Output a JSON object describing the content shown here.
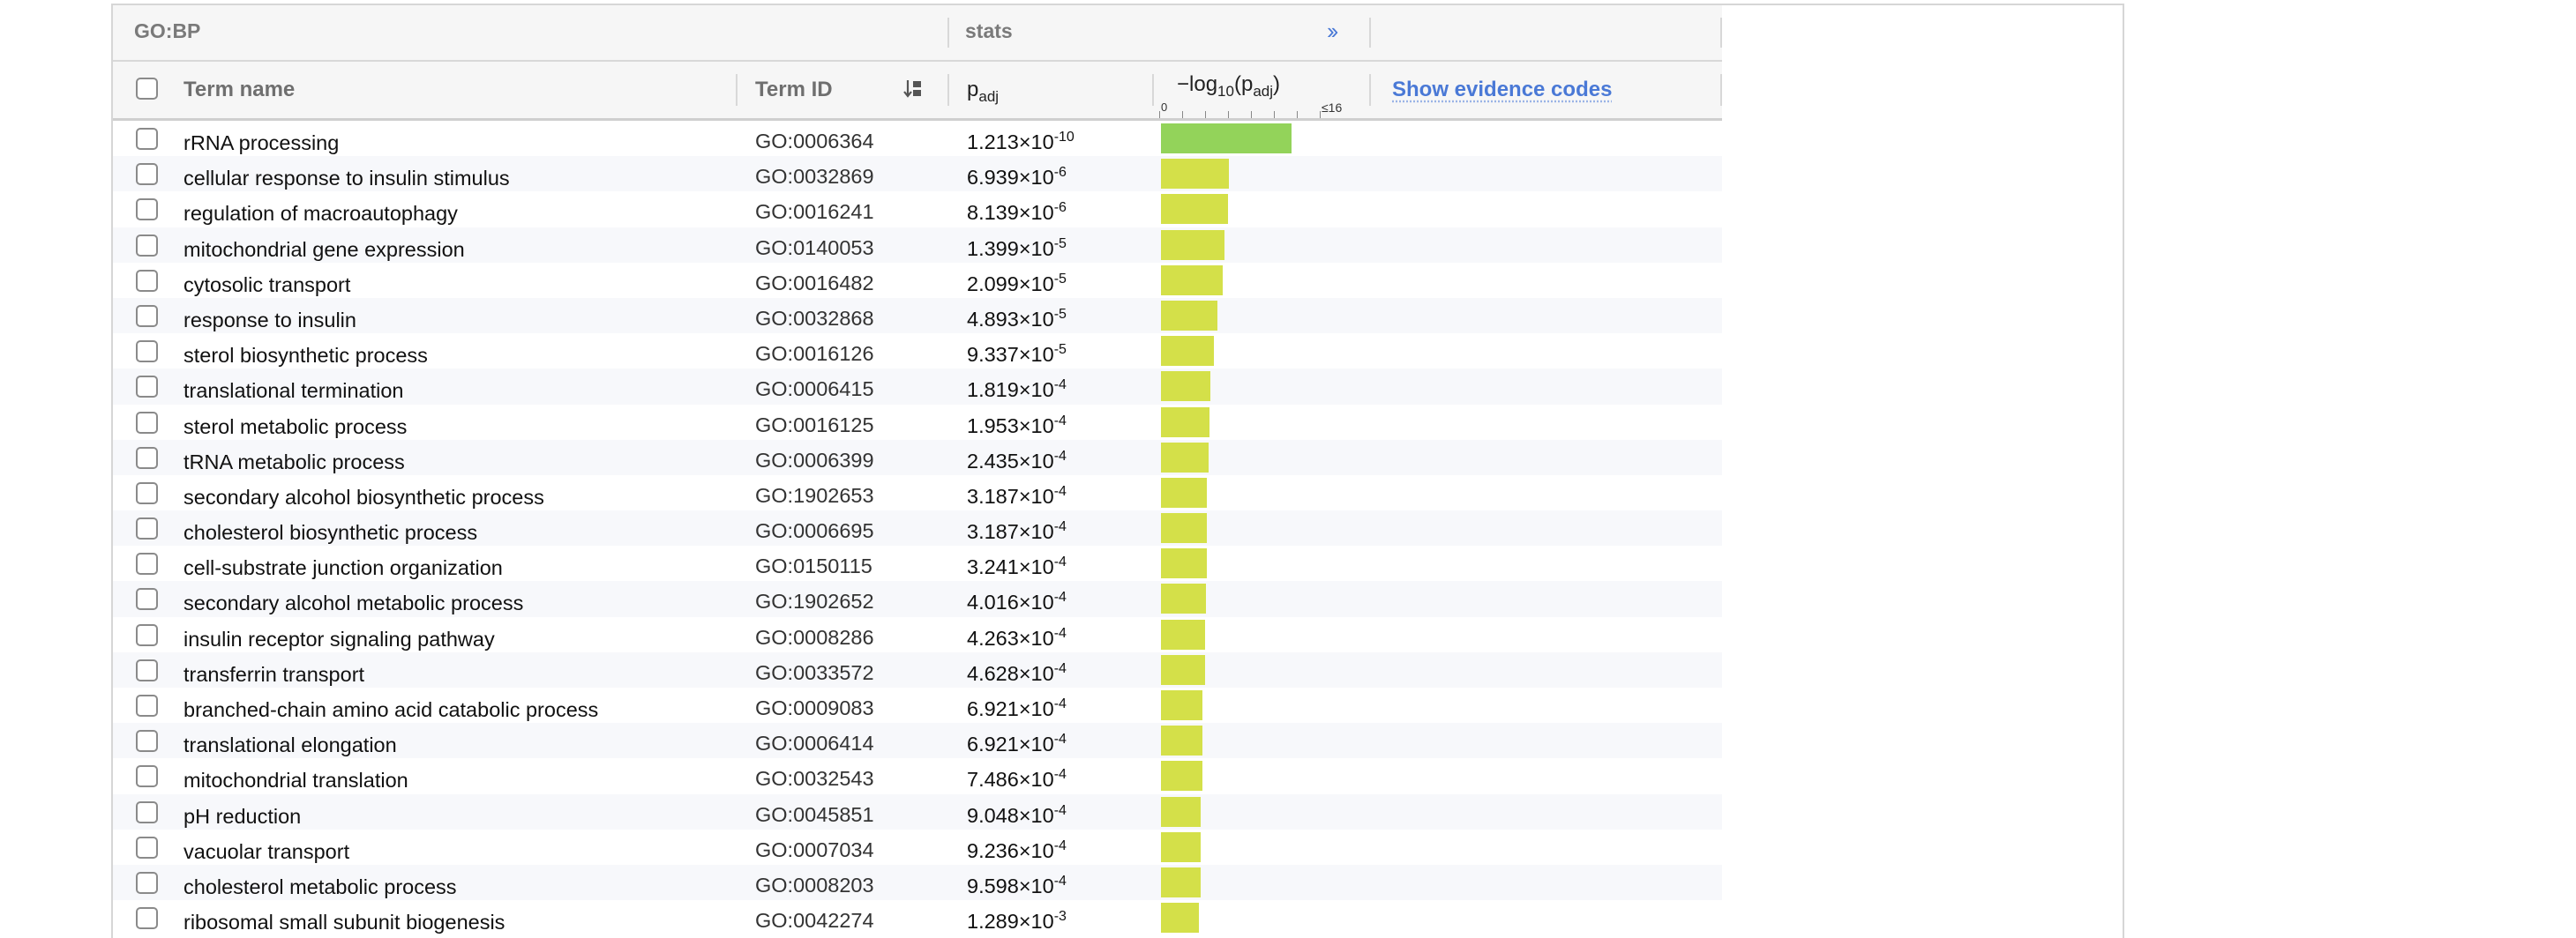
{
  "table": {
    "group_label": "GO:BP",
    "stats_label": "stats",
    "expand_glyph": "››",
    "headers": {
      "term_name": "Term name",
      "term_id": "Term ID",
      "padj_base": "p",
      "padj_sub": "adj",
      "log_prefix": "−log",
      "log_sub": "10",
      "log_open": "(p",
      "log_inner_sub": "adj",
      "log_close": ")",
      "axis_zero": "0",
      "axis_max": "≤16",
      "evidence_link": "Show evidence codes"
    },
    "axis_max_value": 16,
    "bar_colors": {
      "strong": "#93d35a",
      "normal": "#d4e049"
    },
    "icons": {
      "sort": "sort-icon",
      "expand": "double-chevron-right-icon"
    },
    "rows": [
      {
        "name": "rRNA processing",
        "id": "GO:0006364",
        "p_mant": "1.213",
        "p_exp": "-10",
        "neglog": 9.92
      },
      {
        "name": "cellular response to insulin stimulus",
        "id": "GO:0032869",
        "p_mant": "6.939",
        "p_exp": "-6",
        "neglog": 5.16
      },
      {
        "name": "regulation of macroautophagy",
        "id": "GO:0016241",
        "p_mant": "8.139",
        "p_exp": "-6",
        "neglog": 5.09
      },
      {
        "name": "mitochondrial gene expression",
        "id": "GO:0140053",
        "p_mant": "1.399",
        "p_exp": "-5",
        "neglog": 4.85
      },
      {
        "name": "cytosolic transport",
        "id": "GO:0016482",
        "p_mant": "2.099",
        "p_exp": "-5",
        "neglog": 4.68
      },
      {
        "name": "response to insulin",
        "id": "GO:0032868",
        "p_mant": "4.893",
        "p_exp": "-5",
        "neglog": 4.31
      },
      {
        "name": "sterol biosynthetic process",
        "id": "GO:0016126",
        "p_mant": "9.337",
        "p_exp": "-5",
        "neglog": 4.03
      },
      {
        "name": "translational termination",
        "id": "GO:0006415",
        "p_mant": "1.819",
        "p_exp": "-4",
        "neglog": 3.74
      },
      {
        "name": "sterol metabolic process",
        "id": "GO:0016125",
        "p_mant": "1.953",
        "p_exp": "-4",
        "neglog": 3.71
      },
      {
        "name": "tRNA metabolic process",
        "id": "GO:0006399",
        "p_mant": "2.435",
        "p_exp": "-4",
        "neglog": 3.61
      },
      {
        "name": "secondary alcohol biosynthetic process",
        "id": "GO:1902653",
        "p_mant": "3.187",
        "p_exp": "-4",
        "neglog": 3.5
      },
      {
        "name": "cholesterol biosynthetic process",
        "id": "GO:0006695",
        "p_mant": "3.187",
        "p_exp": "-4",
        "neglog": 3.5
      },
      {
        "name": "cell-substrate junction organization",
        "id": "GO:0150115",
        "p_mant": "3.241",
        "p_exp": "-4",
        "neglog": 3.49
      },
      {
        "name": "secondary alcohol metabolic process",
        "id": "GO:1902652",
        "p_mant": "4.016",
        "p_exp": "-4",
        "neglog": 3.4
      },
      {
        "name": "insulin receptor signaling pathway",
        "id": "GO:0008286",
        "p_mant": "4.263",
        "p_exp": "-4",
        "neglog": 3.37
      },
      {
        "name": "transferrin transport",
        "id": "GO:0033572",
        "p_mant": "4.628",
        "p_exp": "-4",
        "neglog": 3.33
      },
      {
        "name": "branched-chain amino acid catabolic process",
        "id": "GO:0009083",
        "p_mant": "6.921",
        "p_exp": "-4",
        "neglog": 3.16
      },
      {
        "name": "translational elongation",
        "id": "GO:0006414",
        "p_mant": "6.921",
        "p_exp": "-4",
        "neglog": 3.16
      },
      {
        "name": "mitochondrial translation",
        "id": "GO:0032543",
        "p_mant": "7.486",
        "p_exp": "-4",
        "neglog": 3.13
      },
      {
        "name": "pH reduction",
        "id": "GO:0045851",
        "p_mant": "9.048",
        "p_exp": "-4",
        "neglog": 3.04
      },
      {
        "name": "vacuolar transport",
        "id": "GO:0007034",
        "p_mant": "9.236",
        "p_exp": "-4",
        "neglog": 3.03
      },
      {
        "name": "cholesterol metabolic process",
        "id": "GO:0008203",
        "p_mant": "9.598",
        "p_exp": "-4",
        "neglog": 3.02
      },
      {
        "name": "ribosomal small subunit biogenesis",
        "id": "GO:0042274",
        "p_mant": "1.289",
        "p_exp": "-3",
        "neglog": 2.89
      }
    ]
  }
}
